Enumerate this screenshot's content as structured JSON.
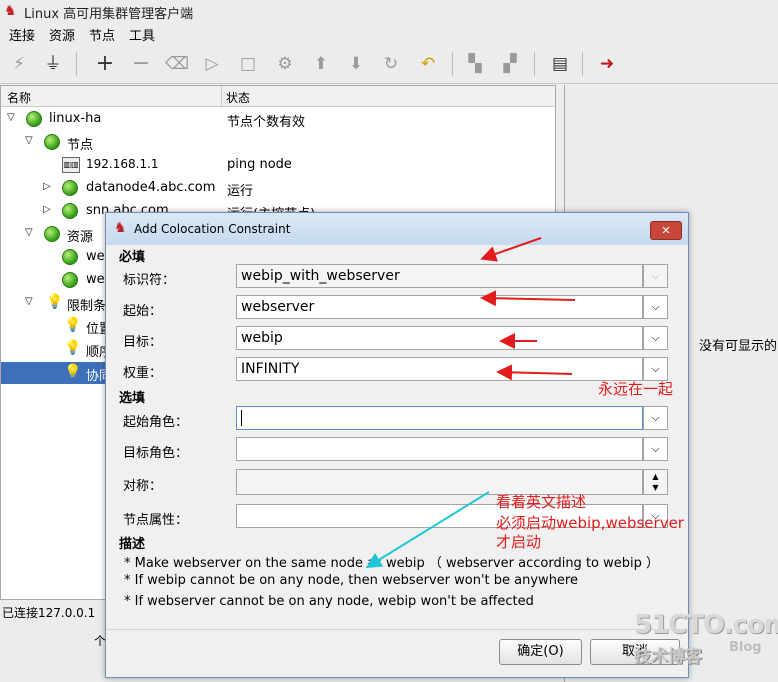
{
  "window": {
    "title": "Linux 高可用集群管理客户端"
  },
  "menu": [
    "连接",
    "资源",
    "节点",
    "工具"
  ],
  "tree": {
    "col_name": "名称",
    "col_status": "状态",
    "rows": [
      {
        "label": "linux-ha",
        "status": "节点个数有效"
      },
      {
        "label": "节点",
        "status": ""
      },
      {
        "label": "192.168.1.1",
        "status": "ping node"
      },
      {
        "label": "datanode4.abc.com",
        "status": "运行"
      },
      {
        "label": "snn.abc.com",
        "status": "运行(主控节点)"
      },
      {
        "label": "资源",
        "status": ""
      },
      {
        "label": "we",
        "status": ""
      },
      {
        "label": "we",
        "status": ""
      },
      {
        "label": "限制条",
        "status": ""
      },
      {
        "label": "位置",
        "status": ""
      },
      {
        "label": "顺序",
        "status": ""
      },
      {
        "label": "协同",
        "status": ""
      }
    ]
  },
  "status_bar": {
    "text": "已连接127.0.0.1",
    "bottom_fragment": "个"
  },
  "right_panel": {
    "message": "没有可显示的i"
  },
  "dialog": {
    "title": "Add Colocation Constraint",
    "required_label": "必填",
    "optional_label": "选填",
    "description_label": "描述",
    "fields": {
      "id": {
        "label": "标识符：",
        "value": "webip_with_webserver"
      },
      "from": {
        "label": "起始：",
        "value": "webserver"
      },
      "to": {
        "label": "目标：",
        "value": "webip"
      },
      "score": {
        "label": "权重：",
        "value": "INFINITY"
      },
      "from_role": {
        "label": "起始角色：",
        "value": ""
      },
      "to_role": {
        "label": "目标角色：",
        "value": ""
      },
      "symmetric": {
        "label": "对称：",
        "value": ""
      },
      "node_attr": {
        "label": "节点属性：",
        "value": ""
      }
    },
    "description_lines": [
      "* Make webserver  on the same node as webip  （ webserver according to webip ）",
      "* If webip cannot be  on any node, then webserver won't be  anywhere",
      "* If webserver cannot be  on any node, webip won't be affected"
    ],
    "ok_label": "确定(O)",
    "cancel_label": "取消"
  },
  "annotations": {
    "together": "永远在一起",
    "note_line1": "看着英文描述",
    "note_line2": "必须启动webip,webserver",
    "note_line3": "才启动",
    "color": "#e21c1c"
  },
  "watermark": {
    "site": "51CTO.com",
    "sub": "技术博客",
    "blog": "Blog"
  },
  "icons": [
    "app-logo-icon",
    "connect-icon",
    "plug-icon",
    "add-icon",
    "remove-icon",
    "clean-icon",
    "start-icon",
    "stop-icon",
    "gear-icon",
    "up-icon",
    "down-icon",
    "redo-icon",
    "undo-icon",
    "node-standby-icon",
    "node-online-icon",
    "log-icon",
    "exit-icon"
  ]
}
